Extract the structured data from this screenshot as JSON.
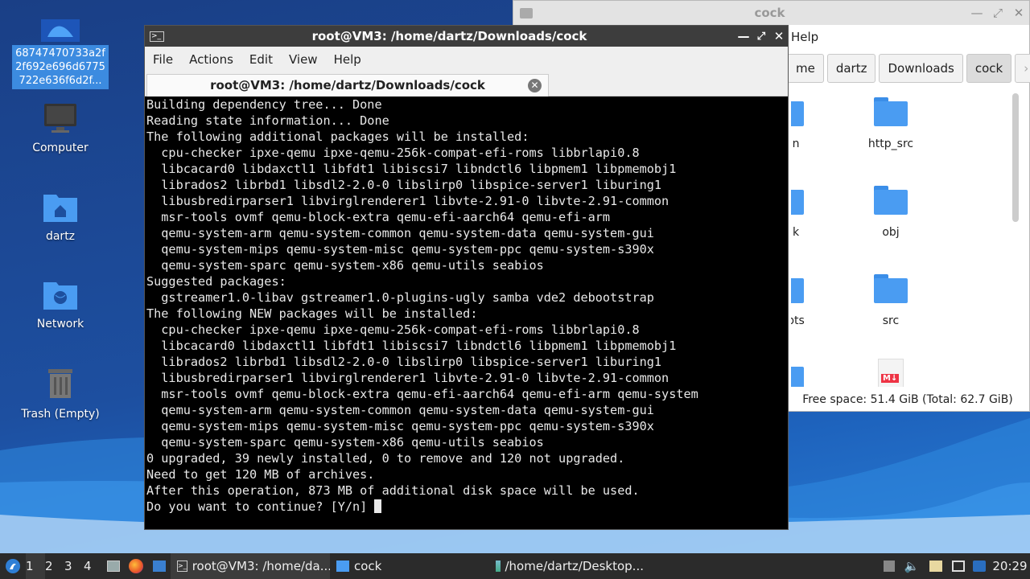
{
  "desktop": {
    "selected_file_label": "68747470733a2f2f692e696d6775722e636f6d2f...",
    "icons": [
      {
        "label": "Computer"
      },
      {
        "label": "dartz"
      },
      {
        "label": "Network"
      },
      {
        "label": "Trash (Empty)"
      }
    ]
  },
  "filemanager": {
    "title": "cock",
    "menu_help": "Help",
    "path": [
      "me",
      "dartz",
      "Downloads",
      "cock"
    ],
    "items": [
      {
        "label": "n"
      },
      {
        "label": "http_src"
      },
      {
        "label": "k"
      },
      {
        "label": "obj"
      },
      {
        "label": "pts"
      },
      {
        "label": "src"
      },
      {
        "label": ""
      },
      {
        "label": "M↓"
      }
    ],
    "status": "Free space: 51.4 GiB (Total: 62.7 GiB)"
  },
  "terminal": {
    "title": "root@VM3: /home/dartz/Downloads/cock",
    "menu": [
      "File",
      "Actions",
      "Edit",
      "View",
      "Help"
    ],
    "tab_title": "root@VM3: /home/dartz/Downloads/cock",
    "lines": [
      "Building dependency tree... Done",
      "Reading state information... Done",
      "The following additional packages will be installed:",
      "  cpu-checker ipxe-qemu ipxe-qemu-256k-compat-efi-roms libbrlapi0.8",
      "  libcacard0 libdaxctl1 libfdt1 libiscsi7 libndctl6 libpmem1 libpmemobj1",
      "  librados2 librbd1 libsdl2-2.0-0 libslirp0 libspice-server1 liburing1",
      "  libusbredirparser1 libvirglrenderer1 libvte-2.91-0 libvte-2.91-common",
      "  msr-tools ovmf qemu-block-extra qemu-efi-aarch64 qemu-efi-arm",
      "  qemu-system-arm qemu-system-common qemu-system-data qemu-system-gui",
      "  qemu-system-mips qemu-system-misc qemu-system-ppc qemu-system-s390x",
      "  qemu-system-sparc qemu-system-x86 qemu-utils seabios",
      "Suggested packages:",
      "  gstreamer1.0-libav gstreamer1.0-plugins-ugly samba vde2 debootstrap",
      "The following NEW packages will be installed:",
      "  cpu-checker ipxe-qemu ipxe-qemu-256k-compat-efi-roms libbrlapi0.8",
      "  libcacard0 libdaxctl1 libfdt1 libiscsi7 libndctl6 libpmem1 libpmemobj1",
      "  librados2 librbd1 libsdl2-2.0-0 libslirp0 libspice-server1 liburing1",
      "  libusbredirparser1 libvirglrenderer1 libvte-2.91-0 libvte-2.91-common",
      "  msr-tools ovmf qemu-block-extra qemu-efi-aarch64 qemu-efi-arm qemu-system",
      "  qemu-system-arm qemu-system-common qemu-system-data qemu-system-gui",
      "  qemu-system-mips qemu-system-misc qemu-system-ppc qemu-system-s390x",
      "  qemu-system-sparc qemu-system-x86 qemu-utils seabios",
      "0 upgraded, 39 newly installed, 0 to remove and 120 not upgraded.",
      "Need to get 120 MB of archives.",
      "After this operation, 873 MB of additional disk space will be used."
    ],
    "prompt": "Do you want to continue? [Y/n] "
  },
  "taskbar": {
    "workspaces": [
      "1",
      "2",
      "3",
      "4"
    ],
    "tasks": [
      {
        "label": "root@VM3: /home/da..."
      },
      {
        "label": "cock"
      },
      {
        "label": "/home/dartz/Desktop..."
      }
    ],
    "clock": "20:29"
  },
  "colors": {
    "accent": "#3c8be0",
    "folder": "#4a9cf2",
    "terminal_bg": "#000000",
    "taskbar_bg": "#2b2b2b"
  }
}
